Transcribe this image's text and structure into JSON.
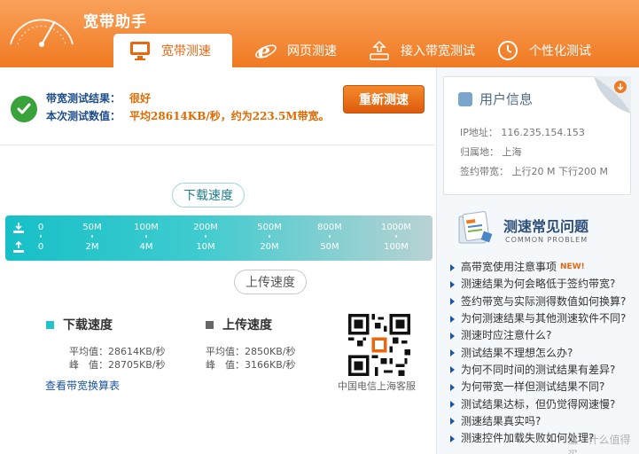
{
  "app": {
    "title": "宽带助手"
  },
  "tabs": [
    {
      "label": "宽带测速",
      "active": true,
      "icon": "monitor-icon"
    },
    {
      "label": "网页测速",
      "active": false,
      "icon": "ie-browser-icon"
    },
    {
      "label": "接入带宽测试",
      "active": false,
      "icon": "router-icon"
    },
    {
      "label": "个性化测试",
      "active": false,
      "icon": "clock-icon"
    }
  ],
  "result": {
    "label1": "带宽测试结果：",
    "value1": "很好",
    "label2": "本次测试数值：",
    "value2": "平均28614KB/秒，约为223.5M带宽。",
    "retest_label": "重新测速"
  },
  "gauge": {
    "download_label": "下载速度",
    "upload_label": "上传速度",
    "download_ticks": [
      "0",
      "50M",
      "100M",
      "200M",
      "500M",
      "800M",
      "1000M"
    ],
    "upload_ticks": [
      "0",
      "2M",
      "4M",
      "10M",
      "20M",
      "50M",
      "100M"
    ]
  },
  "stats": {
    "download": {
      "title": "下载速度",
      "avg": "平均值：28614KB/秒",
      "peak": "峰　值：28705KB/秒"
    },
    "upload": {
      "title": "上传速度",
      "avg": "平均值：2850KB/秒",
      "peak": "峰　值：3166KB/秒"
    },
    "link_label": "查看带宽换算表",
    "qr_label": "中国电信上海客服"
  },
  "user": {
    "title": "用户信息",
    "ip": "IP地址： 116.235.154.153",
    "location": "归属地： 上海",
    "bandwidth": "签约带宽： 上行20 M 下行200 M"
  },
  "faq": {
    "title": "测速常见问题",
    "subtitle": "COMMON PROBLEM",
    "new_tag": "NEW!",
    "items": [
      "高带宽使用注意事项",
      "测速结果为何会略低于签约带宽?",
      "签约带宽与实际测得数值如何换算?",
      "为何测速结果与其他测速软件不同?",
      "测速时应注意什么?",
      "测试结果不理想怎么办?",
      "为何不同时间的测试结果有差异?",
      "为何带宽一样但测试结果不同?",
      "测试结果达标，但仍觉得网速慢?",
      "测速结果真实吗?",
      "测速控件加载失败如何处理?"
    ]
  },
  "watermark": "值 · 什么值得买",
  "colors": {
    "accent": "#f07a22",
    "download": "#22c3c9",
    "upload": "#666666",
    "link": "#1d55a0"
  }
}
